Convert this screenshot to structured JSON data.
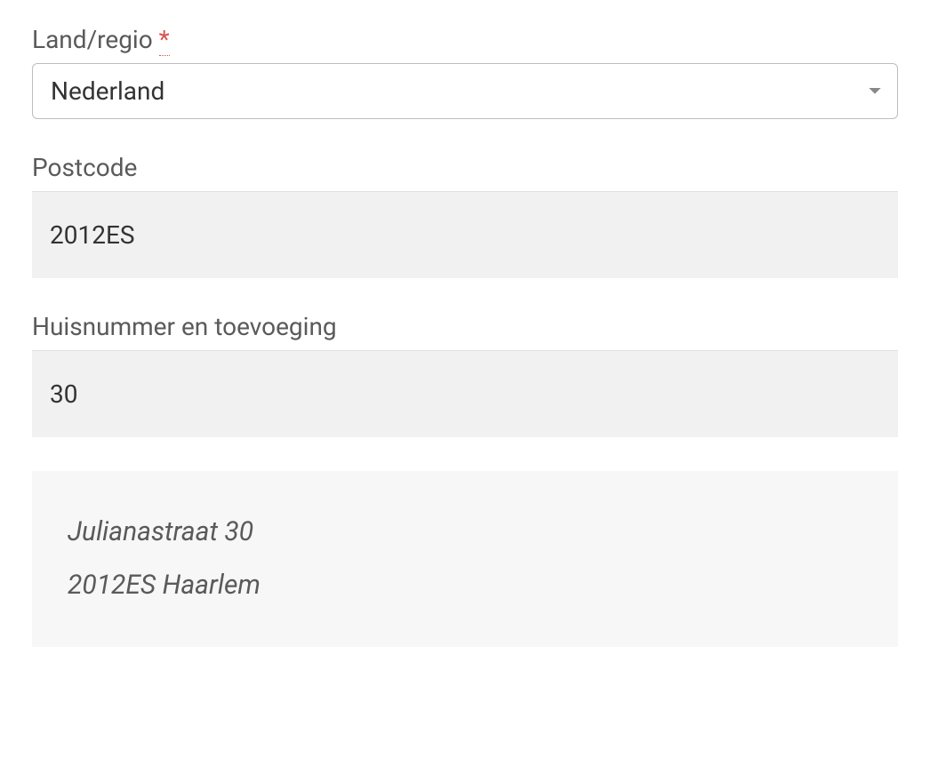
{
  "country": {
    "label": "Land/regio",
    "required_marker": "*",
    "value": "Nederland"
  },
  "postcode": {
    "label": "Postcode",
    "value": "2012ES"
  },
  "housenumber": {
    "label": "Huisnummer en toevoeging",
    "value": "30"
  },
  "resolved": {
    "line1": "Julianastraat 30",
    "line2": "2012ES Haarlem"
  }
}
